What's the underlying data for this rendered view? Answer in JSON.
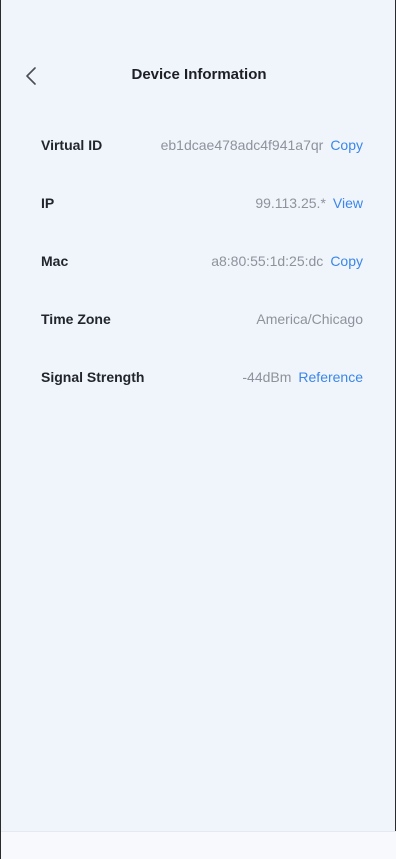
{
  "header": {
    "title": "Device Information"
  },
  "rows": [
    {
      "label": "Virtual ID",
      "value": "eb1dcae478adc4f941a7qr",
      "action": "Copy"
    },
    {
      "label": "IP",
      "value": "99.113.25.*",
      "action": "View"
    },
    {
      "label": "Mac",
      "value": "a8:80:55:1d:25:dc",
      "action": "Copy"
    },
    {
      "label": "Time Zone",
      "value": "America/Chicago",
      "action": ""
    },
    {
      "label": "Signal Strength",
      "value": "-44dBm",
      "action": "Reference"
    }
  ],
  "colors": {
    "background": "#f0f5fc",
    "label": "#22252b",
    "value": "#8e939b",
    "link": "#3b86e8"
  }
}
